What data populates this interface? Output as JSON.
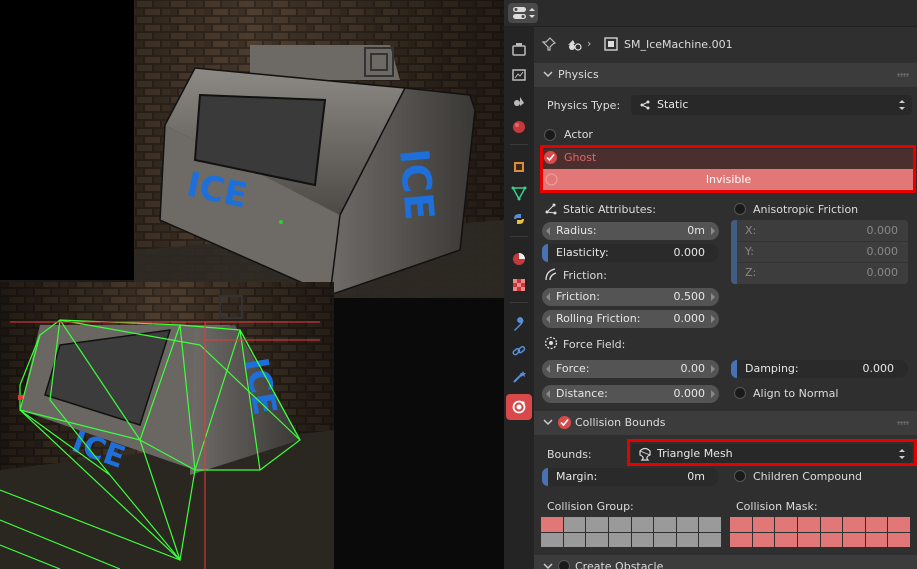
{
  "header": {
    "object_name": "SM_IceMachine.001"
  },
  "physics": {
    "title": "Physics",
    "physics_type_label": "Physics Type:",
    "physics_type_value": "Static",
    "actor_label": "Actor",
    "ghost_label": "Ghost",
    "invisible_label": "Invisible",
    "static_attributes_label": "Static Attributes:",
    "anisotropic_label": "Anisotropic Friction",
    "radius": {
      "label": "Radius:",
      "value": "0m"
    },
    "elasticity": {
      "label": "Elasticity:",
      "value": "0.000"
    },
    "aniso_x": {
      "label": "X:",
      "value": "0.000"
    },
    "aniso_y": {
      "label": "Y:",
      "value": "0.000"
    },
    "aniso_z": {
      "label": "Z:",
      "value": "0.000"
    },
    "friction_header": "Friction:",
    "friction": {
      "label": "Friction:",
      "value": "0.500"
    },
    "rolling_friction": {
      "label": "Rolling Friction:",
      "value": "0.000"
    },
    "force_field_label": "Force Field:",
    "force": {
      "label": "Force:",
      "value": "0.00"
    },
    "damping": {
      "label": "Damping:",
      "value": "0.000"
    },
    "distance": {
      "label": "Distance:",
      "value": "0.000"
    },
    "align_to_normal_label": "Align to Normal"
  },
  "collision_bounds": {
    "title": "Collision Bounds",
    "bounds_label": "Bounds:",
    "bounds_value": "Triangle Mesh",
    "margin": {
      "label": "Margin:",
      "value": "0m"
    },
    "children_compound_label": "Children Compound",
    "collision_group_label": "Collision Group:",
    "collision_mask_label": "Collision Mask:",
    "collision_group_on": [
      0
    ],
    "collision_mask_on": [
      0,
      1,
      2,
      3,
      4,
      5,
      6,
      7,
      8,
      9,
      10,
      11,
      12,
      13,
      14,
      15
    ]
  },
  "create_obstacle": {
    "title": "Create Obstacle"
  },
  "viewport": {
    "sign_text": "ICE"
  },
  "colors": {
    "active_tab": "#d9494a",
    "highlight_red": "#e60000",
    "invisible_bar": "#e27777",
    "accent_blue": "#4772b3",
    "wireframe_green": "#3dff3d"
  },
  "icons": [
    "editor-type-icon",
    "pin-icon",
    "object-data-icon",
    "object-icon",
    "tool-icon",
    "render-icon",
    "output-icon",
    "view-layer-icon",
    "scene-icon",
    "world-icon",
    "object-properties-icon",
    "modifiers-icon",
    "particles-icon",
    "physics-icon",
    "constraints-icon",
    "data-icon",
    "material-icon",
    "texture-icon",
    "game-physics-icon"
  ]
}
